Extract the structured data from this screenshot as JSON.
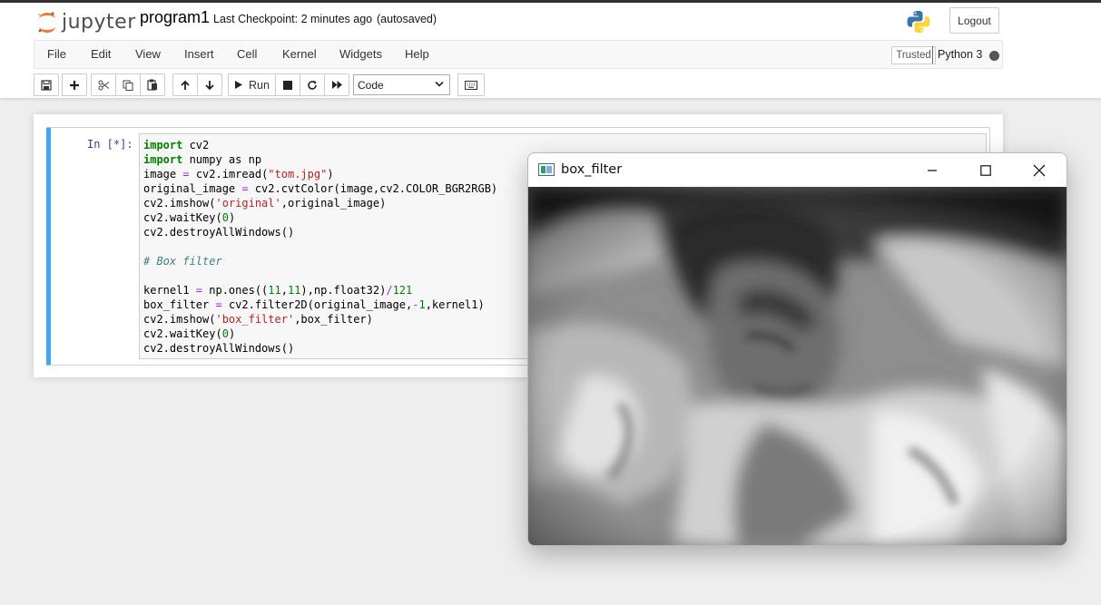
{
  "header": {
    "logo_text": "jupyter",
    "notebook_name": "program1",
    "checkpoint_text": "Last Checkpoint: 2 minutes ago",
    "autosave_text": "(autosaved)",
    "logout_label": "Logout"
  },
  "menu": {
    "items": [
      "File",
      "Edit",
      "View",
      "Insert",
      "Cell",
      "Kernel",
      "Widgets",
      "Help"
    ],
    "trusted_label": "Trusted",
    "kernel_name": "Python 3"
  },
  "toolbar": {
    "run_label": "Run",
    "cell_type": "Code"
  },
  "cell": {
    "prompt": "In [*]:",
    "code_lines": [
      "import cv2",
      "import numpy as np",
      "image = cv2.imread(\"tom.jpg\")",
      "original_image = cv2.cvtColor(image,cv2.COLOR_BGR2RGB)",
      "cv2.imshow('original',original_image)",
      "cv2.waitKey(0)",
      "cv2.destroyAllWindows()",
      "",
      "# Box filter",
      "",
      "kernel1 = np.ones((11,11),np.float32)/121",
      "box_filter = cv2.filter2D(original_image,-1,kernel1)",
      "cv2.imshow('box_filter',box_filter)",
      "cv2.waitKey(0)",
      "cv2.destroyAllWindows()"
    ]
  },
  "window": {
    "title": "box_filter",
    "image_description_icon": "blurred-grayscale-photo"
  },
  "colors": {
    "cell_selected_border": "#42a5f5",
    "prompt": "#303f9f",
    "keyword": "#008000",
    "string": "#ba2121",
    "comment": "#408080"
  }
}
